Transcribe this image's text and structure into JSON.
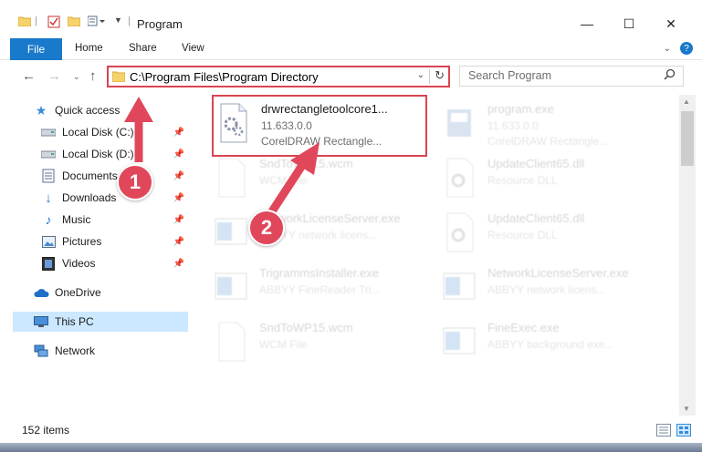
{
  "window": {
    "title": "Program",
    "minimize_glyph": "—",
    "maximize_glyph": "☐",
    "close_glyph": "✕"
  },
  "ribbon": {
    "tabs": [
      "File",
      "Home",
      "Share",
      "View"
    ]
  },
  "address": {
    "path": "C:\\Program Files\\Program Directory"
  },
  "search": {
    "placeholder": "Search Program"
  },
  "sidebar": {
    "items": [
      {
        "label": "Quick access",
        "icon": "star-icon"
      },
      {
        "label": "Local Disk (C:)",
        "icon": "drive-icon",
        "pinned": true
      },
      {
        "label": "Local Disk (D:)",
        "icon": "drive-icon",
        "pinned": true
      },
      {
        "label": "Documents",
        "icon": "documents-icon",
        "pinned": true
      },
      {
        "label": "Downloads",
        "icon": "download-icon",
        "pinned": true
      },
      {
        "label": "Music",
        "icon": "music-icon",
        "pinned": true
      },
      {
        "label": "Pictures",
        "icon": "pictures-icon",
        "pinned": true
      },
      {
        "label": "Videos",
        "icon": "videos-icon",
        "pinned": true
      },
      {
        "label": "OneDrive",
        "icon": "cloud-icon"
      },
      {
        "label": "This PC",
        "icon": "computer-icon",
        "selected": true
      },
      {
        "label": "Network",
        "icon": "network-icon"
      }
    ]
  },
  "files": [
    {
      "name": "drwrectangletoolcore1...",
      "line1": "11.633.0.0",
      "line2": "CorelDRAW Rectangle...",
      "icon": "gear-file-icon",
      "highlight": true
    },
    {
      "name": "program.exe",
      "line1": "11.633.0.0",
      "line2": "CorelDRAW Rectangle...",
      "icon": "app-icon"
    },
    {
      "name": "SndToWP15.wcm",
      "line1": "WCM File",
      "line2": "",
      "icon": "blank-file-icon"
    },
    {
      "name": "UpdateClient65.dll",
      "line1": "Resource DLL",
      "line2": "",
      "icon": "gear-file-icon"
    },
    {
      "name": "NetworkLicenseServer.exe",
      "line1": "ABBYY network licens...",
      "line2": "",
      "icon": "window-icon"
    },
    {
      "name": "UpdateClient65.dll",
      "line1": "Resource DLL",
      "line2": "",
      "icon": "gear-file-icon"
    },
    {
      "name": "TrigrammsInstaller.exe",
      "line1": "ABBYY FineReader Tri...",
      "line2": "",
      "icon": "window-icon"
    },
    {
      "name": "NetworkLicenseServer.exe",
      "line1": "ABBYY network licens...",
      "line2": "",
      "icon": "window-icon"
    },
    {
      "name": "SndToWP15.wcm",
      "line1": "WCM File",
      "line2": "",
      "icon": "blank-file-icon"
    },
    {
      "name": "FineExec.exe",
      "line1": "ABBYY background exe...",
      "line2": "",
      "icon": "window-icon"
    }
  ],
  "status": {
    "count": "152 items"
  },
  "annotations": {
    "step1": "1",
    "step2": "2",
    "color": "#e0475b"
  }
}
